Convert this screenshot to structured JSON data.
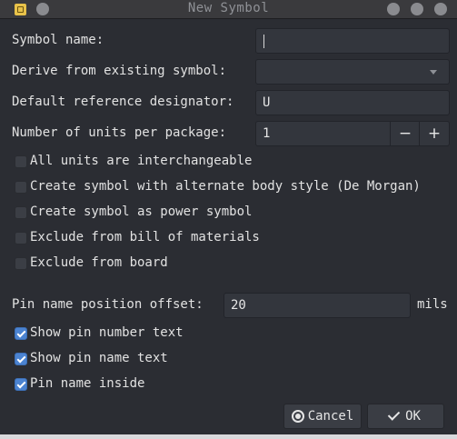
{
  "window": {
    "title": "New Symbol"
  },
  "form": {
    "symbol_name": {
      "label": "Symbol name:",
      "value": ""
    },
    "derive_from": {
      "label": "Derive from existing symbol:",
      "value": ""
    },
    "ref_designator": {
      "label": "Default reference designator:",
      "value": "U"
    },
    "units_per_package": {
      "label": "Number of units per package:",
      "value": "1",
      "minus": "−",
      "plus": "+"
    },
    "checkboxes": [
      {
        "label": "All units are interchangeable",
        "checked": false
      },
      {
        "label": "Create symbol with alternate body style (De Morgan)",
        "checked": false
      },
      {
        "label": "Create symbol as power symbol",
        "checked": false
      },
      {
        "label": "Exclude from bill of materials",
        "checked": false
      },
      {
        "label": "Exclude from board",
        "checked": false
      }
    ],
    "pin_offset": {
      "label": "Pin name position offset:",
      "value": "20",
      "unit": "mils"
    },
    "pin_checkboxes": [
      {
        "label": "Show pin number text",
        "checked": true
      },
      {
        "label": "Show pin name text",
        "checked": true
      },
      {
        "label": "Pin name inside",
        "checked": true
      }
    ]
  },
  "buttons": {
    "cancel": "Cancel",
    "ok": "OK"
  },
  "icons": {
    "app": "kicad-app-icon",
    "combo": "chevron-down-icon",
    "cancel": "cancel-icon",
    "ok": "checkmark-icon"
  },
  "colors": {
    "accent": "#4b83d1",
    "background": "#2b2d33",
    "field": "#33363d"
  }
}
